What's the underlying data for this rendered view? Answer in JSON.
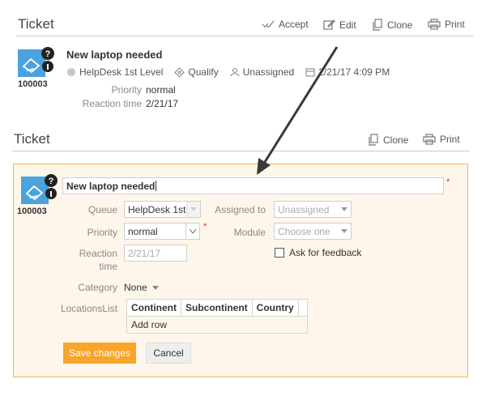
{
  "view_panel": {
    "title": "Ticket",
    "toolbar": {
      "accept": "Accept",
      "edit": "Edit",
      "clone": "Clone",
      "print": "Print"
    },
    "ticket_number": "100003",
    "subject": "New laptop needed",
    "queue": "HelpDesk 1st Level",
    "state": "Qualify",
    "assignee": "Unassigned",
    "datetime": "2/21/17 4:09 PM",
    "priority_label": "Priority",
    "priority_value": "normal",
    "reaction_label": "Reaction time",
    "reaction_value": "2/21/17"
  },
  "edit_panel": {
    "title": "Ticket",
    "toolbar": {
      "clone": "Clone",
      "print": "Print"
    },
    "ticket_number": "100003",
    "subject_value": "New laptop needed",
    "queue_label": "Queue",
    "queue_value": "HelpDesk 1st",
    "assigned_label": "Assigned to",
    "assigned_value": "Unassigned",
    "priority_label": "Priority",
    "priority_value": "normal",
    "module_label": "Module",
    "module_value": "Choose one",
    "reaction_label_1": "Reaction",
    "reaction_label_2": "time",
    "reaction_placeholder": "2/21/17",
    "feedback_label": "Ask for feedback",
    "category_label": "Category",
    "category_value": "None",
    "locations_label": "LocationsList",
    "locations_columns": [
      "Continent",
      "Subcontinent",
      "Country"
    ],
    "add_row": "Add row",
    "save_label": "Save changes",
    "cancel_label": "Cancel",
    "required_mark": "*"
  },
  "colors": {
    "accent": "#f7a52b",
    "ticket_icon": "#4aa3df",
    "required": "#e0322d",
    "panel_border": "#f7b54a"
  }
}
